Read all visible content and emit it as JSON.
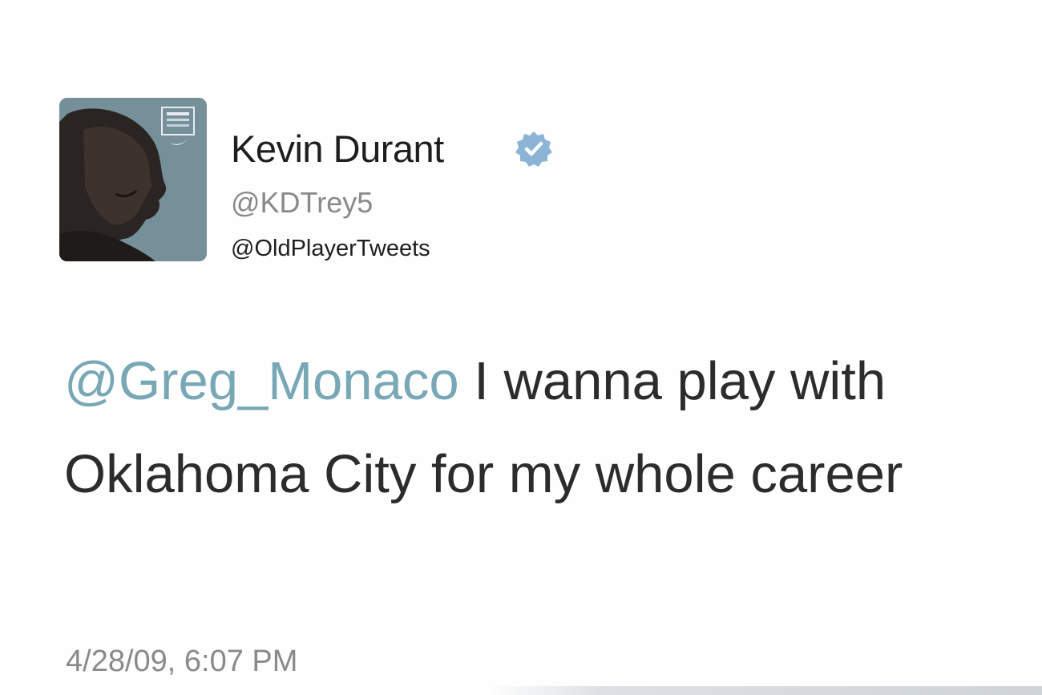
{
  "tweet": {
    "display_name": "Kevin Durant",
    "verified_icon": "verified-badge-icon",
    "handle": "@KDTrey5",
    "watermark": "@OldPlayerTweets",
    "mention": "@Greg_Monaco",
    "body": " I wanna play with Oklahoma City for my whole career",
    "timestamp": "4/28/09, 6:07 PM",
    "avatar": "profile-avatar"
  },
  "colors": {
    "mention": "#78a7b6",
    "verified": "#8cb4d6",
    "secondary_text": "#8a8a8a",
    "avatar_bg": "#6f8a95"
  }
}
